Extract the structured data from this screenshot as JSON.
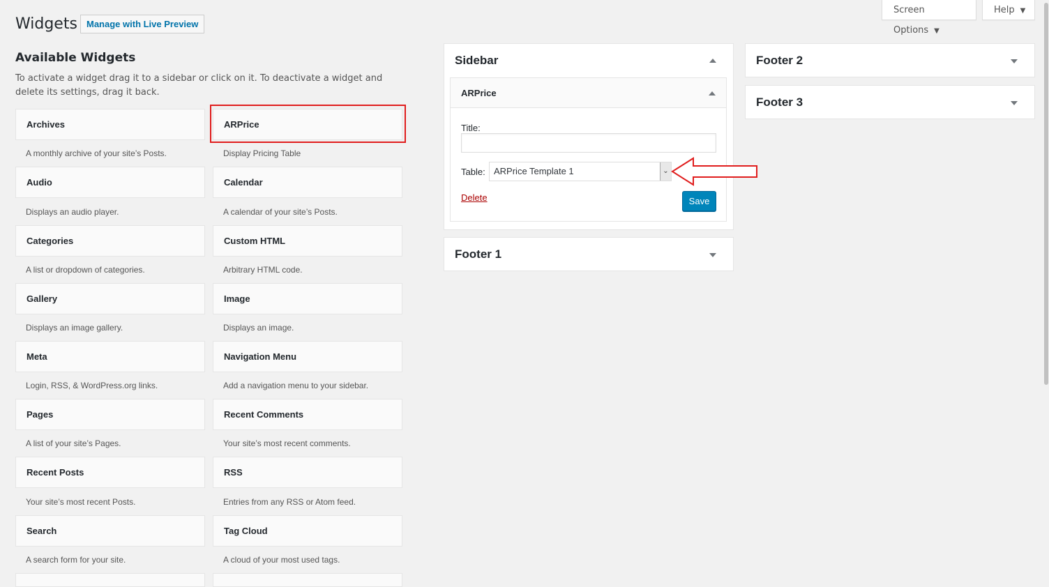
{
  "header": {
    "title": "Widgets",
    "live_preview_label": "Manage with Live Preview",
    "screen_options_label": "Screen Options",
    "help_label": "Help"
  },
  "available": {
    "title": "Available Widgets",
    "description": "To activate a widget drag it to a sidebar or click on it. To deactivate a widget and delete its settings, drag it back.",
    "left": [
      {
        "name": "Archives",
        "desc": "A monthly archive of your site’s Posts."
      },
      {
        "name": "Audio",
        "desc": "Displays an audio player."
      },
      {
        "name": "Categories",
        "desc": "A list or dropdown of categories."
      },
      {
        "name": "Gallery",
        "desc": "Displays an image gallery."
      },
      {
        "name": "Meta",
        "desc": "Login, RSS, & WordPress.org links."
      },
      {
        "name": "Pages",
        "desc": "A list of your site’s Pages."
      },
      {
        "name": "Recent Posts",
        "desc": "Your site’s most recent Posts."
      },
      {
        "name": "Search",
        "desc": "A search form for your site."
      }
    ],
    "right": [
      {
        "name": "ARPrice",
        "desc": "Display Pricing Table"
      },
      {
        "name": "Calendar",
        "desc": "A calendar of your site’s Posts."
      },
      {
        "name": "Custom HTML",
        "desc": "Arbitrary HTML code."
      },
      {
        "name": "Image",
        "desc": "Displays an image."
      },
      {
        "name": "Navigation Menu",
        "desc": "Add a navigation menu to your sidebar."
      },
      {
        "name": "Recent Comments",
        "desc": "Your site’s most recent comments."
      },
      {
        "name": "RSS",
        "desc": "Entries from any RSS or Atom feed."
      },
      {
        "name": "Tag Cloud",
        "desc": "A cloud of your most used tags."
      }
    ]
  },
  "sidebar": {
    "title": "Sidebar",
    "widget": {
      "name": "ARPrice",
      "title_label": "Title:",
      "title_value": "",
      "table_label": "Table:",
      "table_selected": "ARPrice Template 1",
      "delete_label": "Delete",
      "save_label": "Save"
    }
  },
  "footer1": {
    "title": "Footer 1"
  },
  "footer2": {
    "title": "Footer 2"
  },
  "footer3": {
    "title": "Footer 3"
  },
  "colors": {
    "accent": "#0085ba",
    "annotation": "#e01d1d",
    "delete": "#aa0000"
  },
  "icons": {
    "toggle": "triangle-toggle-icon",
    "annotation": "red-arrow-icon"
  }
}
